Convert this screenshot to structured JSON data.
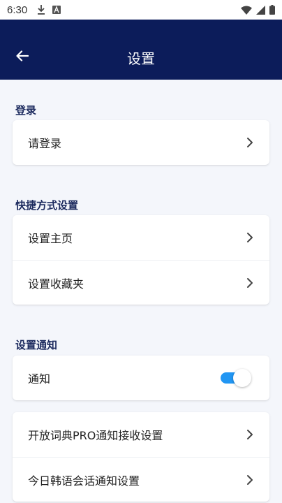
{
  "status_bar": {
    "time": "6:30",
    "icons": [
      "download-icon",
      "text-a-icon",
      "wifi-icon",
      "signal-icon",
      "battery-icon"
    ]
  },
  "app_bar": {
    "title": "设置",
    "back_icon": "arrow-left-icon"
  },
  "sections": {
    "login": {
      "title": "登录",
      "items": [
        {
          "label": "请登录"
        }
      ]
    },
    "shortcut": {
      "title": "快捷方式设置",
      "items": [
        {
          "label": "设置主页"
        },
        {
          "label": "设置收藏夹"
        }
      ]
    },
    "notification": {
      "title": "设置通知",
      "toggle_item": {
        "label": "通知",
        "enabled": true
      },
      "items": [
        {
          "label": "开放词典PRO通知接收设置"
        },
        {
          "label": "今日韩语会话通知设置"
        }
      ]
    }
  },
  "colors": {
    "app_bar": "#0c1c5a",
    "accent": "#2196f3",
    "section_title": "#1c2a5e",
    "background": "#f4f6fb"
  }
}
